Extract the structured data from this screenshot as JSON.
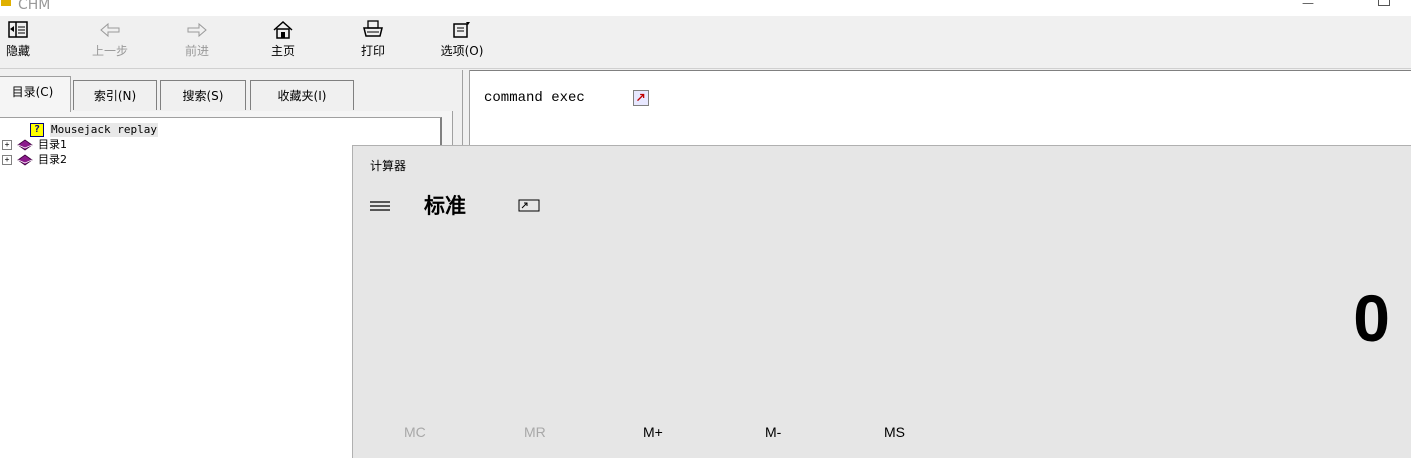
{
  "window": {
    "title": "CHM"
  },
  "toolbar": {
    "hide": "隐藏",
    "back": "上一步",
    "forward": "前进",
    "home": "主页",
    "print": "打印",
    "options": "选项(O)"
  },
  "tabs": {
    "contents": "目录(C)",
    "index": "索引(N)",
    "search": "搜索(S)",
    "favorites": "收藏夹(I)"
  },
  "tree": {
    "items": [
      {
        "label": "Mousejack replay",
        "icon": "help-page-icon"
      },
      {
        "label": "目录1",
        "icon": "book-icon"
      },
      {
        "label": "目录2",
        "icon": "book-icon"
      }
    ]
  },
  "content": {
    "text": "command exec"
  },
  "calculator": {
    "title": "计算器",
    "mode": "标准",
    "display": "0",
    "memory": [
      "MC",
      "MR",
      "M+",
      "M-",
      "MS"
    ]
  },
  "colors": {
    "book": "#8b1a8b",
    "content_bg": "#ffffff",
    "calc_bg": "#e6e6e6"
  }
}
